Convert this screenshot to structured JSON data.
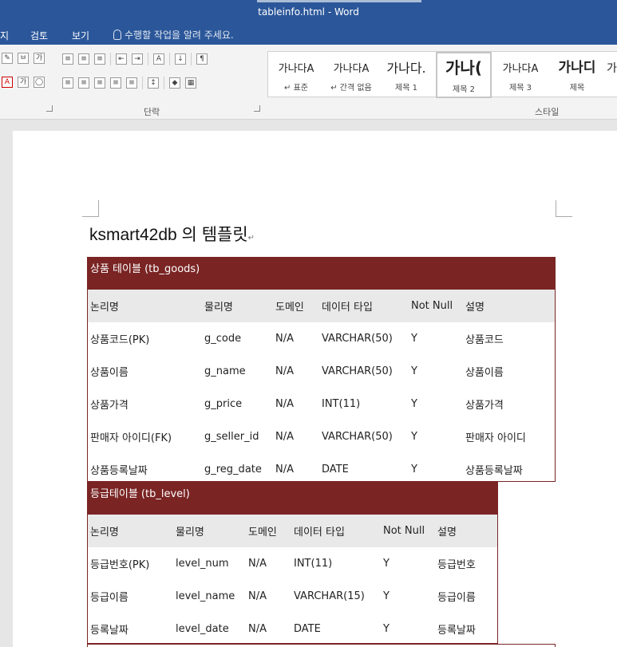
{
  "window": {
    "title": "tableinfo.html - Word"
  },
  "tabs": [
    {
      "label": "지"
    },
    {
      "label": "검토"
    },
    {
      "label": "보기"
    }
  ],
  "tellme": {
    "placeholder": "수행할 작업을 알려 주세요."
  },
  "ribbon": {
    "paragraph_label": "단락",
    "styles_label": "스타일",
    "styles": [
      {
        "sample": "가나다A",
        "name": "↵ 표준"
      },
      {
        "sample": "가나다A",
        "name": "↵ 간격 없음"
      },
      {
        "sample": "가나다.",
        "name": "제목 1"
      },
      {
        "sample": "가나(",
        "name": "제목 2"
      },
      {
        "sample": "가나다A",
        "name": "제목 3"
      },
      {
        "sample": "가나디",
        "name": "제목"
      },
      {
        "sample": "가",
        "name": ""
      }
    ]
  },
  "document": {
    "heading": "ksmart42db 의 템플릿",
    "tables": [
      {
        "caption": "상품 테이블 (tb_goods)",
        "headers": [
          "논리명",
          "물리명",
          "도메인",
          "데이터 타입",
          "Not Null",
          "설명"
        ],
        "rows": [
          [
            "상품코드(PK)",
            "g_code",
            "N/A",
            "VARCHAR(50)",
            "Y",
            "상품코드"
          ],
          [
            "상품이름",
            "g_name",
            "N/A",
            "VARCHAR(50)",
            "Y",
            "상품이름"
          ],
          [
            "상품가격",
            "g_price",
            "N/A",
            "INT(11)",
            "Y",
            "상품가격"
          ],
          [
            "판매자 아이디(FK)",
            "g_seller_id",
            "N/A",
            "VARCHAR(50)",
            "Y",
            "판매자 아이디"
          ],
          [
            "상품등록날짜",
            "g_reg_date",
            "N/A",
            "DATE",
            "Y",
            "상품등록날짜"
          ]
        ]
      },
      {
        "caption": "등급테이블 (tb_level)",
        "headers": [
          "논리명",
          "물리명",
          "도메인",
          "데이터 타입",
          "Not Null",
          "설명"
        ],
        "rows": [
          [
            "등급번호(PK)",
            "level_num",
            "N/A",
            "INT(11)",
            "Y",
            "등급번호"
          ],
          [
            "등급이름",
            "level_name",
            "N/A",
            "VARCHAR(15)",
            "Y",
            "등급이름"
          ],
          [
            "등록날짜",
            "level_date",
            "N/A",
            "DATE",
            "Y",
            "등록날짜"
          ]
        ]
      }
    ]
  }
}
